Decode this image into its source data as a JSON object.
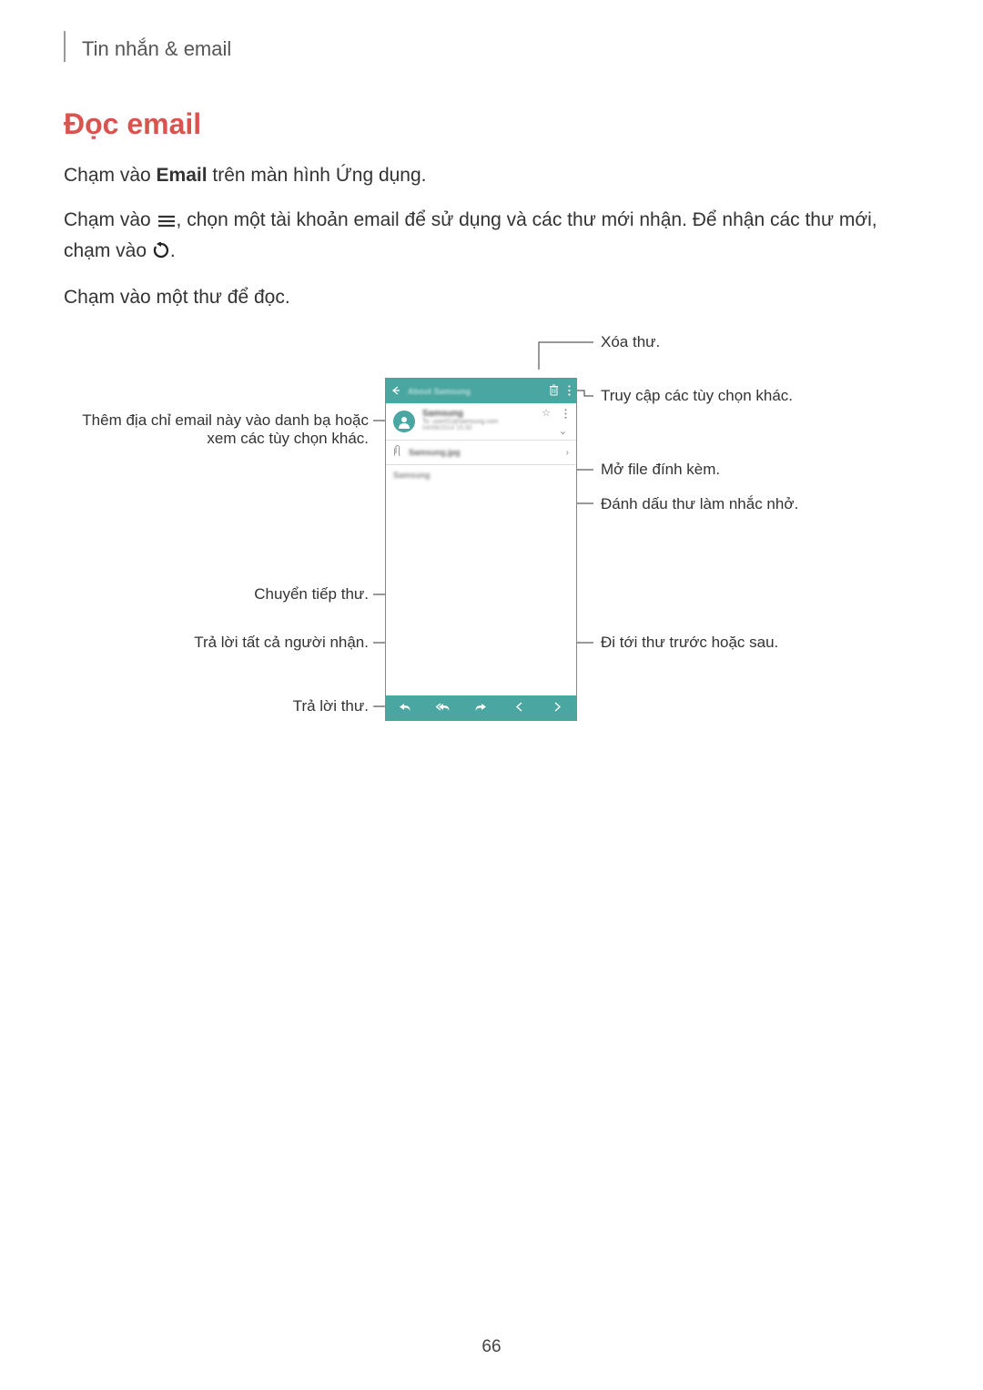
{
  "breadcrumb": "Tin nhắn & email",
  "heading": "Đọc email",
  "para1_pre": "Chạm vào ",
  "para1_bold": "Email",
  "para1_post": " trên màn hình Ứng dụng.",
  "para2_a": "Chạm vào ",
  "para2_b": ", chọn một tài khoản email để sử dụng và các thư mới nhận. Để nhận các thư mới, chạm vào ",
  "para2_c": ".",
  "para3": "Chạm vào một thư để đọc.",
  "callouts": {
    "delete": "Xóa thư.",
    "more_options": "Truy cập các tùy chọn khác.",
    "add_contact": "Thêm địa chỉ email này vào danh bạ hoặc xem các tùy chọn khác.",
    "open_attach": "Mở file đính kèm.",
    "reminder": "Đánh dấu thư làm nhắc nhở.",
    "forward": "Chuyển tiếp thư.",
    "reply_all": "Trả lời tất cả người nhận.",
    "prev_next": "Đi tới thư trước hoặc sau.",
    "reply": "Trả lời thư."
  },
  "phone": {
    "header_title": "About Samsung",
    "sender": "Samsung",
    "to_line": "To: user01@samsung.com",
    "date_line": "04/08/2014 15:30",
    "attach_name": "Samsung.jpg",
    "body": "Samsung"
  },
  "page_number": "66"
}
